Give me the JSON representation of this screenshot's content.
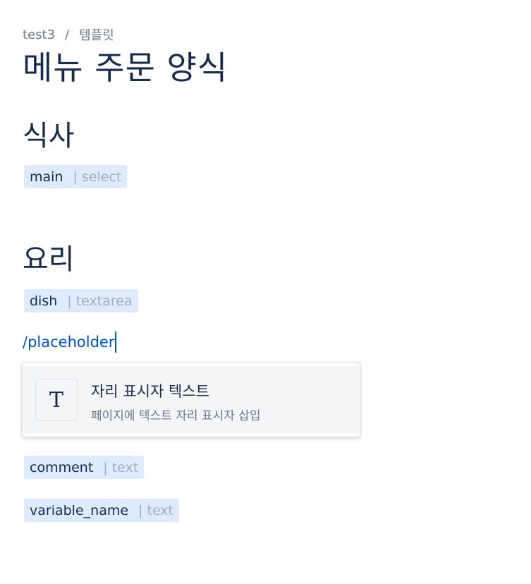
{
  "breadcrumb": {
    "space": "test3",
    "separator": "/",
    "current": "템플릿"
  },
  "page_title": "메뉴 주문 양식",
  "sections": [
    {
      "heading": "식사",
      "fields": [
        {
          "name": "main",
          "type": "| select"
        }
      ]
    },
    {
      "heading": "요리",
      "fields": [
        {
          "name": "dish",
          "type": "| textarea"
        }
      ]
    }
  ],
  "editor": {
    "slash_command_text": "/placeholder"
  },
  "slash_menu": {
    "items": [
      {
        "icon": "text-T-icon",
        "icon_glyph": "T",
        "title": "자리 표시자 텍스트",
        "description": "페이지에 텍스트 자리 표시자 삽입"
      }
    ]
  },
  "trailing_fields": [
    {
      "name": "comment",
      "type": "| text"
    },
    {
      "name": "variable_name",
      "type": "| text"
    }
  ],
  "colors": {
    "chip_background": "#deebff",
    "link_blue": "#0052cc",
    "text_primary": "#172b4d",
    "text_secondary": "#6b778c",
    "text_muted": "#a5adba"
  }
}
